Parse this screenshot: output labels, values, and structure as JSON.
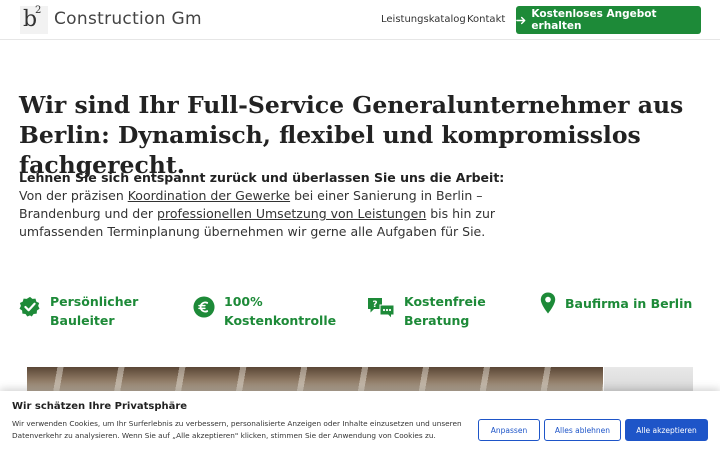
{
  "header": {
    "brand_name": "Construction Gm",
    "logo_letter": "b",
    "logo_superscript": "2",
    "nav": [
      "Leistungskatalog",
      "Kontakt"
    ],
    "cta_label": "Kostenloses Angebot erhalten",
    "cta_icon": "arrow-right-icon"
  },
  "hero": {
    "title": "Wir sind Ihr Full-Service Generalunternehmer aus Berlin: Dynamisch, flexibel und kompromisslos fachgerecht.",
    "intro_bold": "Lehnen Sie sich entspannt zurück und überlassen Sie uns die Arbeit:",
    "intro_part1": "Von der präzisen ",
    "intro_link1": "Koordination der Gewerke",
    "intro_part2": " bei einer Sanierung in Berlin – Brandenburg und der ",
    "intro_link2": "professionellen Umsetzung von Leistungen",
    "intro_part3": " bis hin zur umfassenden Terminplanung übernehmen wir gerne alle Aufgaben für Sie."
  },
  "features": [
    {
      "line1": "Persönlicher",
      "line2": "Bauleiter",
      "icon": "badge-check-icon"
    },
    {
      "line1": "100%",
      "line2": "Kostenkontrolle",
      "icon": "euro-icon"
    },
    {
      "line1": "Kostenfreie",
      "line2": "Beratung",
      "icon": "chat-question-icon"
    },
    {
      "line1": "Baufirma in Berlin",
      "line2": "",
      "icon": "map-pin-icon"
    }
  ],
  "cookie": {
    "title": "Wir schätzen Ihre Privatsphäre",
    "text": "Wir verwenden Cookies, um Ihr Surferlebnis zu verbessern, personalisierte Anzeigen oder Inhalte einzusetzen und unseren Datenverkehr zu analysieren. Wenn Sie auf „Alle akzeptieren\" klicken, stimmen Sie der Anwendung von Cookies zu.",
    "btn_customize": "Anpassen",
    "btn_reject": "Alles ablehnen",
    "btn_accept": "Alle akzeptieren"
  },
  "colors": {
    "accent_green": "#1d8a38",
    "cookie_blue": "#1e55c8"
  }
}
